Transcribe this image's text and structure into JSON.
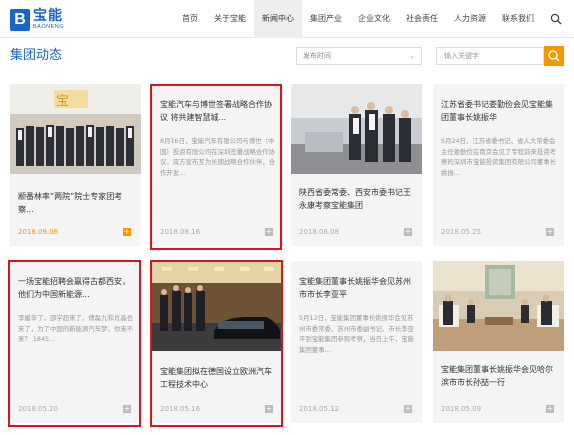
{
  "brand": {
    "mark": "B",
    "name_cn": "宝能",
    "name_en": "BAONENG",
    "color": "#1a66c6"
  },
  "nav": {
    "items": [
      "首页",
      "关于宝能",
      "新闻中心",
      "集团产业",
      "企业文化",
      "社会责任",
      "人力资源",
      "联系我们"
    ],
    "active_index": 2
  },
  "page": {
    "title": "集团动态"
  },
  "filters": {
    "date_placeholder": "发布时间",
    "search_placeholder": "输入关键字",
    "accent": "#f39800"
  },
  "cards": [
    {
      "title": "颛番林率“两院”院士专家团考察...",
      "date": "2018.09.06",
      "highlight_color": "#f39800"
    },
    {
      "title": "宝能汽车与博世签署战略合作协议 将共建智慧城...",
      "desc": "8月16日，宝能汽车有限公司与博世（中国）投资有限公司在深圳签署战略合作协议，双方宣布互为长期战略合作伙伴，合作开发...",
      "date": "2018.08.16"
    },
    {
      "title": "陕西省委常委、西安市委书记王永康考察宝能集团",
      "date": "2018.06.08"
    },
    {
      "title": "江苏省委书记娄勤俭会见宝能集团董事长姚振华",
      "desc": "5月24日，江苏省委书记、省人大常委会主任娄勤俭在南京会见了专程前来投资考察的深圳市宝能投资集团有限公司董事长姚振...",
      "date": "2018.05.25"
    },
    {
      "title": "一场宝能招聘会赢得古都西安，他们为中国新能源...",
      "desc": "李媛辛了，邵学超来了，傅磊九和肖晶也来了，为了中国的新能源汽车梦，你来不来？ 1845...",
      "date": "2018.05.20"
    },
    {
      "title": "宝能集团拟在德国设立欧洲汽车工程技术中心",
      "date": "2018.05.16"
    },
    {
      "title": "宝能集团董事长姚振华会见苏州市市长李亚平",
      "desc": "5月12日，宝能集团董事长姚振华会见苏州市委常委、苏州市委副书记、市长李亚平到宝能集团参观考察，当日上午，宝能集团董事...",
      "date": "2018.05.12"
    },
    {
      "title": "宝能集团董事长姚振华会见哈尔滨市市长孙喆一行",
      "date": "2018.05.09"
    }
  ]
}
